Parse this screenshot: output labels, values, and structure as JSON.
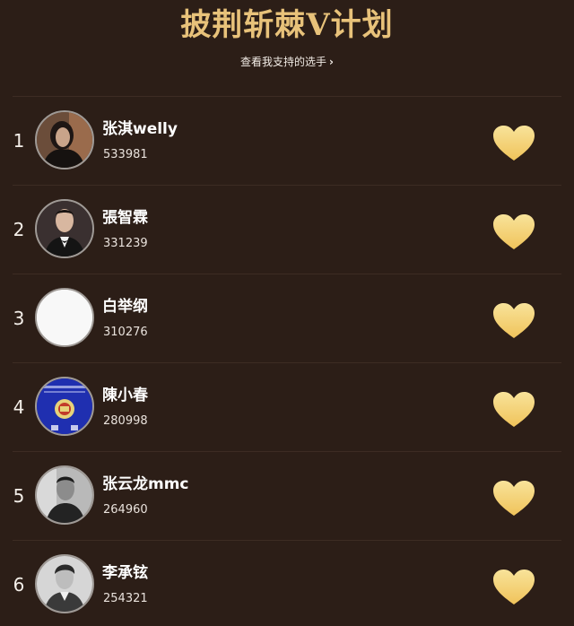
{
  "header": {
    "title": "披荆斩棘V计划",
    "link_label": "查看我支持的选手",
    "link_chevron": "›"
  },
  "colors": {
    "background": "#2c1e17",
    "title": "#e8c27a",
    "heart_top": "#f8e39a",
    "heart_bottom": "#f0c35a"
  },
  "contestants": [
    {
      "rank": "1",
      "name": "张淇welly",
      "votes": "533981",
      "avatar": "portrait-dark-hair"
    },
    {
      "rank": "2",
      "name": "張智霖",
      "votes": "331239",
      "avatar": "portrait-suit"
    },
    {
      "rank": "3",
      "name": "白举纲",
      "votes": "310276",
      "avatar": "blank-white"
    },
    {
      "rank": "4",
      "name": "陳小春",
      "votes": "280998",
      "avatar": "blue-emblem"
    },
    {
      "rank": "5",
      "name": "张云龙mmc",
      "votes": "264960",
      "avatar": "portrait-bw"
    },
    {
      "rank": "6",
      "name": "李承铉",
      "votes": "254321",
      "avatar": "portrait-bw-light"
    }
  ],
  "icons": {
    "vote": "heart-icon",
    "link": "chevron-right-icon"
  }
}
